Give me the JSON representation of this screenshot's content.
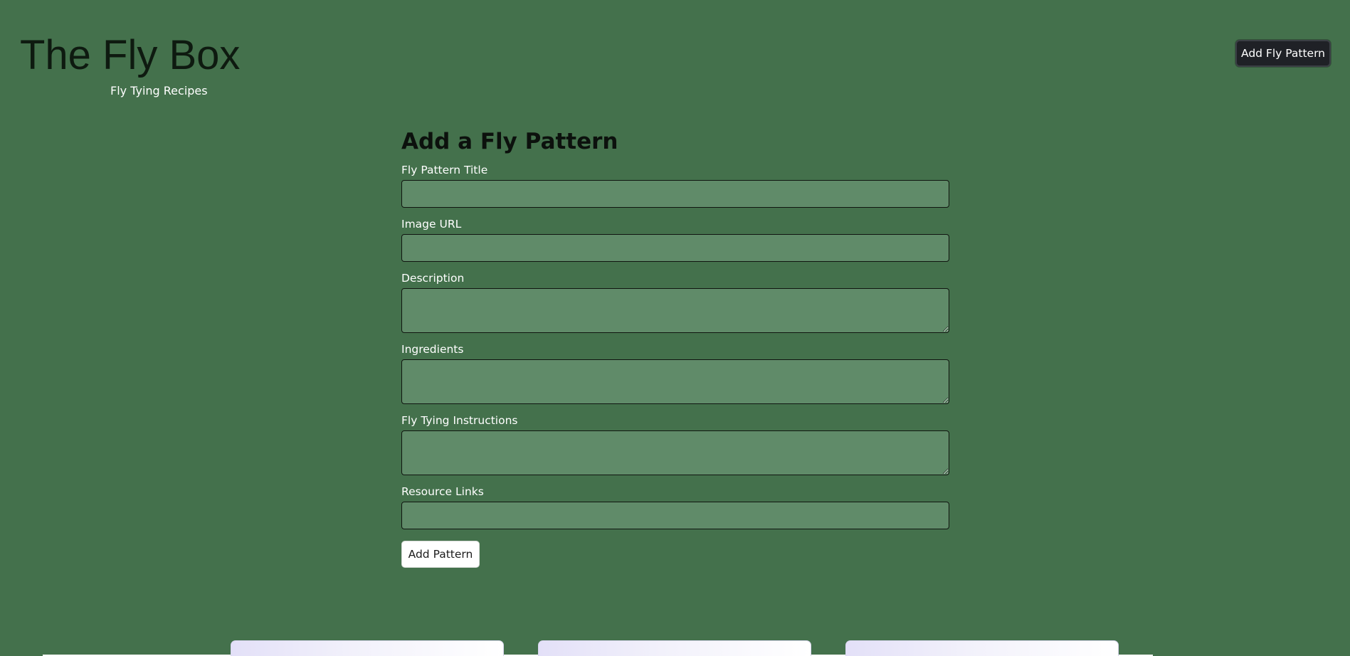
{
  "header": {
    "title": "The Fly Box",
    "subtitle": "Fly Tying Recipes",
    "nav_button_label": "Add Fly Pattern"
  },
  "form": {
    "heading": "Add a Fly Pattern",
    "fields": {
      "title": {
        "label": "Fly Pattern Title",
        "value": "",
        "placeholder": ""
      },
      "image_url": {
        "label": "Image URL",
        "value": "",
        "placeholder": ""
      },
      "description": {
        "label": "Description",
        "value": "",
        "placeholder": ""
      },
      "ingredients": {
        "label": "Ingredients",
        "value": "",
        "placeholder": ""
      },
      "instructions": {
        "label": "Fly Tying Instructions",
        "value": "",
        "placeholder": ""
      },
      "resource_links": {
        "label": "Resource Links",
        "value": "",
        "placeholder": ""
      }
    },
    "submit_label": "Add Pattern"
  },
  "colors": {
    "page_background": "#44714c",
    "input_background": "#608b69",
    "nav_button_background": "#1f2126",
    "submit_button_background": "#ffffff"
  }
}
